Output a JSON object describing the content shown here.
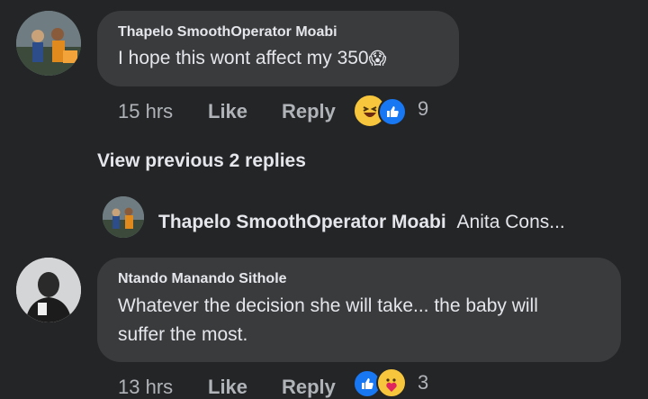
{
  "comment1": {
    "author": "Thapelo SmoothOperator Moabi",
    "text": "I hope this wont affect my 350",
    "emoji": "😱",
    "time": "15 hrs",
    "like_label": "Like",
    "reply_label": "Reply",
    "reaction_count": "9"
  },
  "view_previous": {
    "label": "View previous 2 replies"
  },
  "reply_preview": {
    "author": "Thapelo SmoothOperator Moabi",
    "snippet": "Anita Cons..."
  },
  "comment2": {
    "author": "Ntando Manando Sithole",
    "text_line1": "Whatever the decision she will take... the baby will",
    "text_line2": "suffer the most.",
    "time": "13 hrs",
    "like_label": "Like",
    "reply_label": "Reply",
    "reaction_count": "3"
  },
  "colors": {
    "background": "#242526",
    "bubble": "#3a3b3c",
    "like_blue": "#1877f2",
    "haha_yellow": "#f7c63c"
  }
}
